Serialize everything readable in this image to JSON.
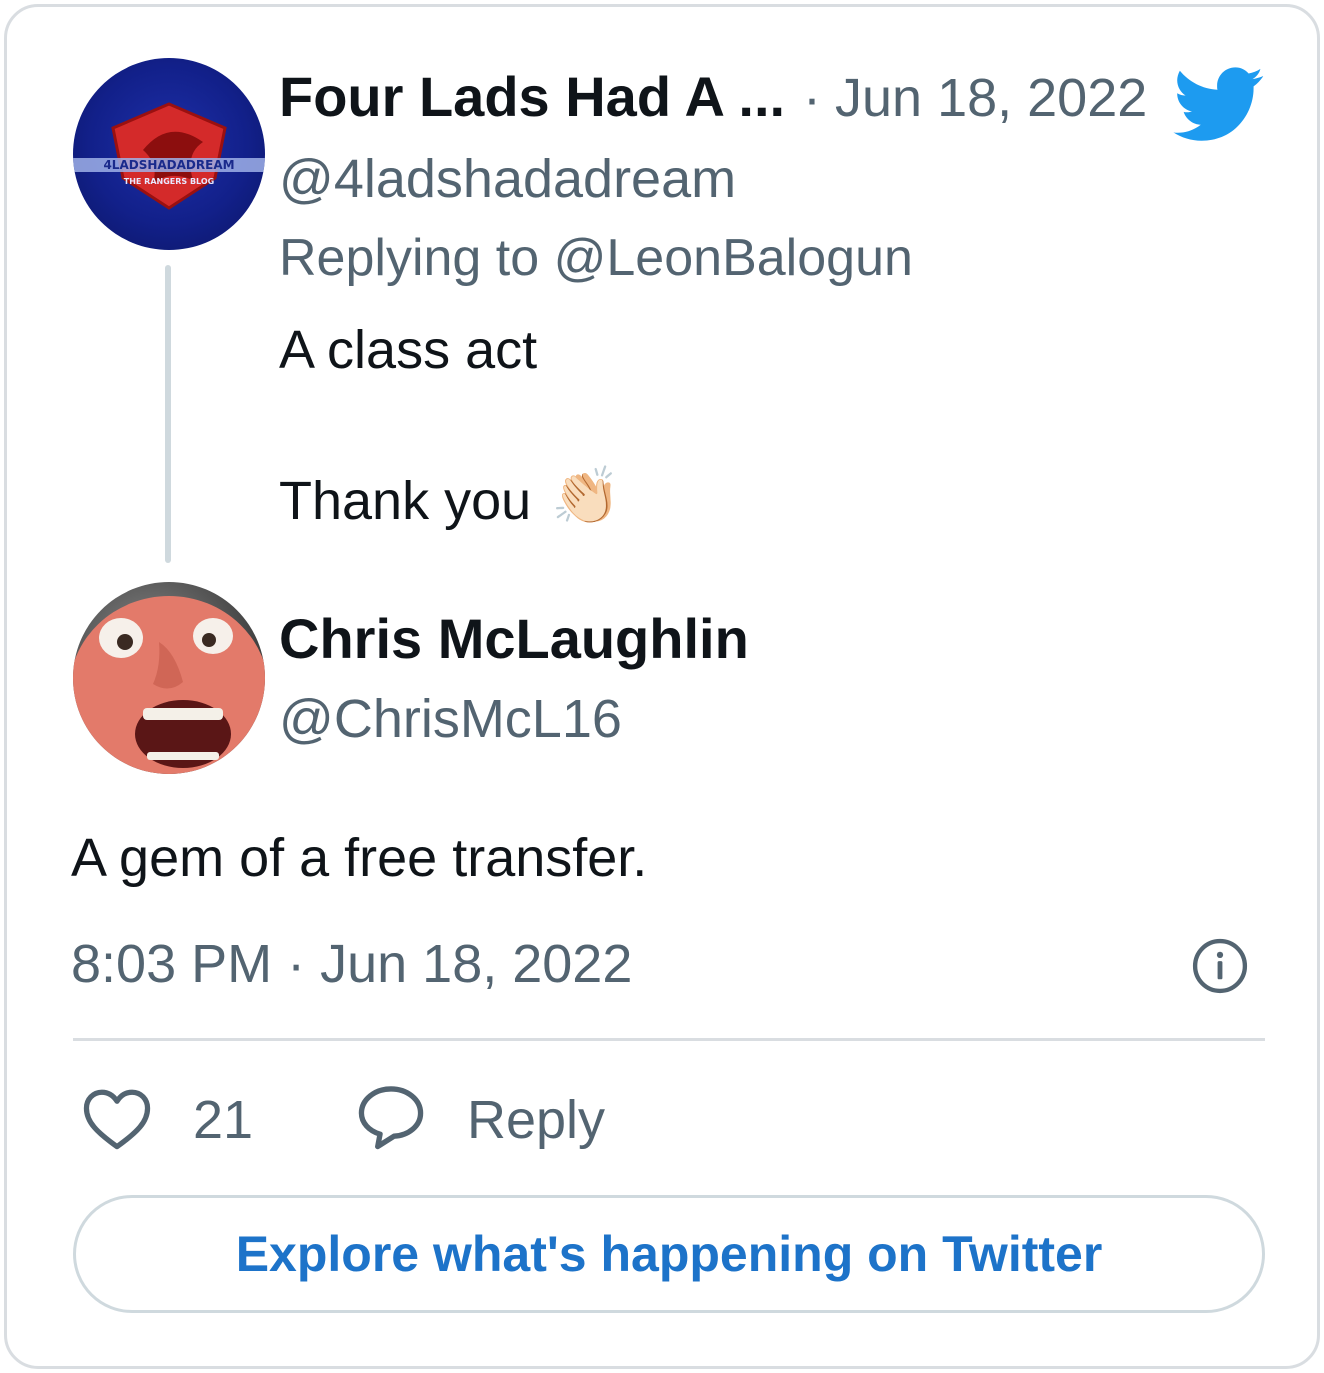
{
  "parent_tweet": {
    "author_name": "Four Lads Had A ...",
    "date_separator": "·",
    "date": "Jun 18, 2022",
    "handle": "@4ladshadadream",
    "replying_to": "Replying to @LeonBalogun",
    "text_line_1": "A class act",
    "text_line_2": "Thank you",
    "emoji": "👏🏻",
    "avatar_icon": "four-lads-logo-avatar",
    "avatar_caption_1": "4LADSHADADREAM",
    "avatar_caption_2": "THE RANGERS BLOG"
  },
  "main_tweet": {
    "author_name": "Chris McLaughlin",
    "handle": "@ChrisMcL16",
    "text": "A gem of a free transfer.",
    "timestamp": "8:03 PM · Jun 18, 2022",
    "avatar_icon": "cartoon-face-avatar"
  },
  "actions": {
    "like_count": "21",
    "reply_label": "Reply"
  },
  "explore_button": {
    "label": "Explore what's happening on Twitter"
  },
  "icons": {
    "brand": "twitter-bird-icon",
    "info": "info-icon",
    "like": "heart-icon",
    "reply": "speech-bubble-icon"
  },
  "colors": {
    "twitter_blue": "#1d9bf0",
    "link_blue": "#1d73c9",
    "secondary_text": "#536471",
    "primary_text": "#0f1419",
    "border": "#d9dde1"
  }
}
